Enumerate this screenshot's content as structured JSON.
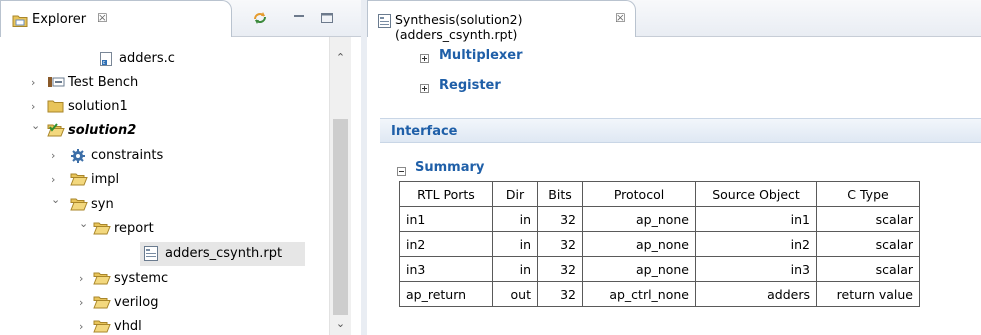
{
  "explorer": {
    "tab_title": "Explorer",
    "close_glyph": "☒",
    "tree": [
      {
        "label": "adders.c",
        "icon": "c-file-icon",
        "indent": 0,
        "arrow": "",
        "style": "normal"
      },
      {
        "label": "Test Bench",
        "icon": "testbench-icon",
        "indent": 0,
        "arrow": "›",
        "style": "normal"
      },
      {
        "label": "solution1",
        "icon": "folder-icon",
        "indent": 0,
        "arrow": "›",
        "style": "normal"
      },
      {
        "label": "solution2",
        "icon": "solution-active-icon",
        "indent": 0,
        "arrow": "⌄",
        "style": "bold-italic"
      },
      {
        "label": "constraints",
        "icon": "gear-icon",
        "indent": 1,
        "arrow": "›",
        "style": "normal"
      },
      {
        "label": "impl",
        "icon": "folder-open-icon",
        "indent": 1,
        "arrow": "›",
        "style": "normal"
      },
      {
        "label": "syn",
        "icon": "folder-open-icon",
        "indent": 1,
        "arrow": "⌄",
        "style": "normal"
      },
      {
        "label": "report",
        "icon": "folder-open-icon",
        "indent": 2,
        "arrow": "⌄",
        "style": "normal"
      },
      {
        "label": "adders_csynth.rpt",
        "icon": "report-file-icon",
        "indent": 3,
        "arrow": "",
        "style": "selected"
      },
      {
        "label": "systemc",
        "icon": "folder-open-icon",
        "indent": 2,
        "arrow": "›",
        "style": "normal"
      },
      {
        "label": "verilog",
        "icon": "folder-open-icon",
        "indent": 2,
        "arrow": "›",
        "style": "normal"
      },
      {
        "label": "vhdl",
        "icon": "folder-open-icon",
        "indent": 2,
        "arrow": "›",
        "style": "normal"
      }
    ]
  },
  "editor": {
    "tab_title": "Synthesis(solution2)(adders_csynth.rpt)",
    "close_glyph": "☒",
    "sections": {
      "multiplexer": "Multiplexer",
      "register": "Register",
      "interface": "Interface",
      "summary": "Summary"
    },
    "table": {
      "headers": [
        "RTL Ports",
        "Dir",
        "Bits",
        "Protocol",
        "Source Object",
        "C Type"
      ],
      "rows": [
        [
          "in1",
          "in",
          "32",
          "ap_none",
          "in1",
          "scalar"
        ],
        [
          "in2",
          "in",
          "32",
          "ap_none",
          "in2",
          "scalar"
        ],
        [
          "in3",
          "in",
          "32",
          "ap_none",
          "in3",
          "scalar"
        ],
        [
          "ap_return",
          "out",
          "32",
          "ap_ctrl_none",
          "adders",
          "return value"
        ]
      ]
    }
  },
  "colors": {
    "link_blue": "#1f5fa8",
    "folder_yellow": "#e8c45a",
    "selection": "#e6e6e6"
  }
}
